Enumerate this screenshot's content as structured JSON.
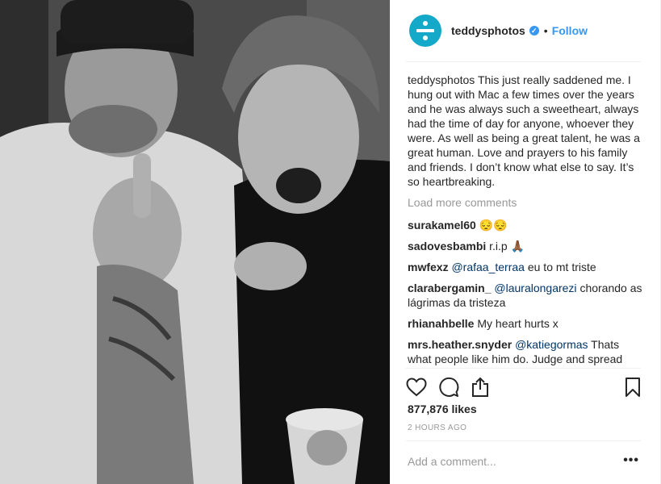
{
  "post": {
    "username": "teddysphotos",
    "verified_icon": "verified-badge-icon",
    "separator": "•",
    "follow_label": "Follow",
    "caption_text": "This just really saddened me. I hung out with Mac a few times over the years and he was always such a sweetheart, always had the time of day for anyone, whoever they were. As well as being a great talent, he was a great human. Love and prayers to his family and friends. I don’t know what else to say. It’s so heartbreaking.",
    "load_more_label": "Load more comments",
    "comments": [
      {
        "user": "surakamel60",
        "text": "😔😔",
        "mention": ""
      },
      {
        "user": "sadovesbambi",
        "text": "r.i.p 🙏🏾",
        "mention": ""
      },
      {
        "user": "mwfexz",
        "mention": "@rafaa_terraa",
        "text": "eu to mt triste"
      },
      {
        "user": "clarabergamin_",
        "mention": "@lauralongarezi",
        "text": "chorando as lágrimas da tristeza"
      },
      {
        "user": "rhianahbelle",
        "text": "My heart hurts x",
        "mention": ""
      },
      {
        "user": "mrs.heather.snyder",
        "mention": "@katiegormas",
        "text": "Thats what people like him do. Judge and spread"
      }
    ],
    "likes": "877,876 likes",
    "time": "2 HOURS AGO",
    "add_comment_placeholder": "Add a comment...",
    "more_label": "•••"
  },
  "colors": {
    "accent": "#3897f0",
    "avatar": "#14a8c9",
    "mention": "#003569",
    "muted": "#999999"
  },
  "icons": {
    "like": "heart-icon",
    "comment": "comment-bubble-icon",
    "share": "share-icon",
    "save": "bookmark-icon"
  }
}
